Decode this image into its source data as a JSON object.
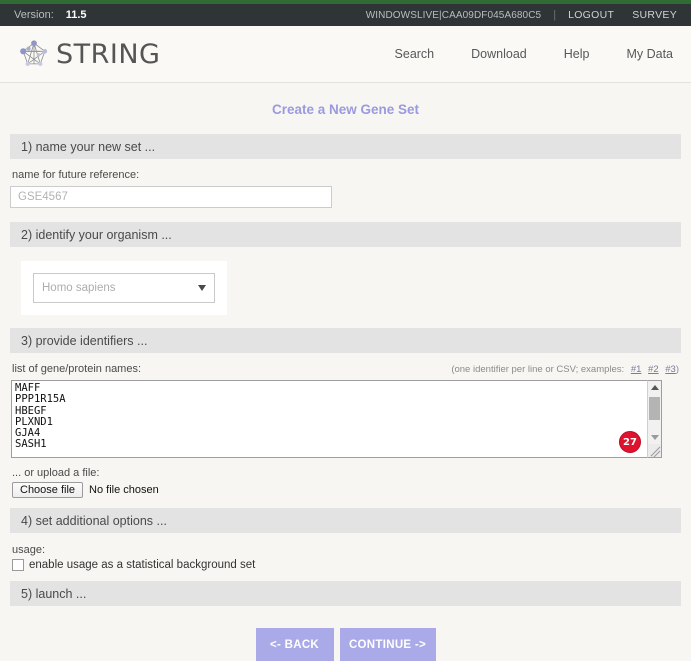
{
  "topbar": {
    "version_label": "Version:",
    "version_value": "11.5",
    "user_id": "WINDOWSLIVE|CAA09DF045A680C5",
    "divider": "|",
    "logout": "LOGOUT",
    "survey": "SURVEY"
  },
  "header": {
    "brand": "STRING",
    "nav": [
      {
        "label": "Search"
      },
      {
        "label": "Download"
      },
      {
        "label": "Help"
      },
      {
        "label": "My Data"
      }
    ]
  },
  "page": {
    "title": "Create a New Gene Set"
  },
  "step1": {
    "header": "1) name your new set ...",
    "label": "name for future reference:",
    "input_value": "GSE4567",
    "input_placeholder": "GSE4567"
  },
  "step2": {
    "header": "2) identify your organism ...",
    "selected": "Homo sapiens"
  },
  "step3": {
    "header": "3) provide identifiers ...",
    "label": "list of gene/protein names:",
    "hint_prefix": "(one identifier per line or CSV; examples:",
    "hint_links": [
      "#1",
      "#2",
      "#3"
    ],
    "hint_suffix": ")",
    "identifiers": "MAFF\nPPP1R15A\nHBEGF\nPLXND1\nGJA4\nSASH1\n",
    "identifier_count": "27",
    "upload_label": "... or upload a file:",
    "choose_file": "Choose file",
    "file_status": "No file chosen"
  },
  "step4": {
    "header": "4) set additional options ...",
    "usage_label": "usage:",
    "checkbox_label": "enable usage as a statistical background set",
    "checked": false
  },
  "step5": {
    "header": "5) launch ...",
    "back_button": "<- BACK",
    "continue_button": "CONTINUE ->"
  },
  "colors": {
    "accent": "#9a9ae0",
    "button": "#aaaae8",
    "topbar": "#2f3437",
    "stripe_green": "#2f6b32",
    "badge_red": "#e0132f",
    "section_bar": "#e3e3e3",
    "page_bg": "#f7f6f2"
  }
}
